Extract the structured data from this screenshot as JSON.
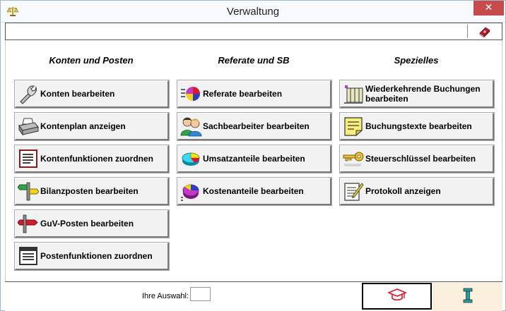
{
  "window": {
    "title": "Verwaltung",
    "close_label": "✕"
  },
  "columns": [
    {
      "heading": "Konten und Posten",
      "buttons": [
        {
          "label": "Konten bearbeiten",
          "icon": "wrench-icon"
        },
        {
          "label": "Kontenplan anzeigen",
          "icon": "printer-icon"
        },
        {
          "label": "Kontenfunktionen zuordnen",
          "icon": "document-list-icon"
        },
        {
          "label": "Bilanzposten bearbeiten",
          "icon": "signpost-icon"
        },
        {
          "label": "GuV-Posten bearbeiten",
          "icon": "signpost-red-icon"
        },
        {
          "label": "Postenfunktionen zuordnen",
          "icon": "document-lines-icon"
        }
      ]
    },
    {
      "heading": "Referate und SB",
      "buttons": [
        {
          "label": "Referate bearbeiten",
          "icon": "pie-chart-icon"
        },
        {
          "label": "Sachbearbeiter bearbeiten",
          "icon": "people-icon"
        },
        {
          "label": "Umsatzanteile bearbeiten",
          "icon": "pie-chart-cyan-icon"
        },
        {
          "label": "Kostenanteile bearbeiten",
          "icon": "pie-chart-magenta-icon"
        }
      ]
    },
    {
      "heading": "Spezielles",
      "buttons": [
        {
          "label": "Wiederkehrende Buchungen bearbeiten",
          "icon": "recurring-bookings-icon"
        },
        {
          "label": "Buchungstexte bearbeiten",
          "icon": "note-icon"
        },
        {
          "label": "Steuerschlüssel bearbeiten",
          "icon": "key-icon"
        },
        {
          "label": "Protokoll anzeigen",
          "icon": "log-pencil-icon"
        }
      ]
    }
  ],
  "status": {
    "choice_label": "Ihre Auswahl:",
    "choice_value": ""
  },
  "colors": {
    "close": "#c74b4b",
    "info_bg": "#fbf0dd",
    "accent_red": "#d9182d"
  }
}
